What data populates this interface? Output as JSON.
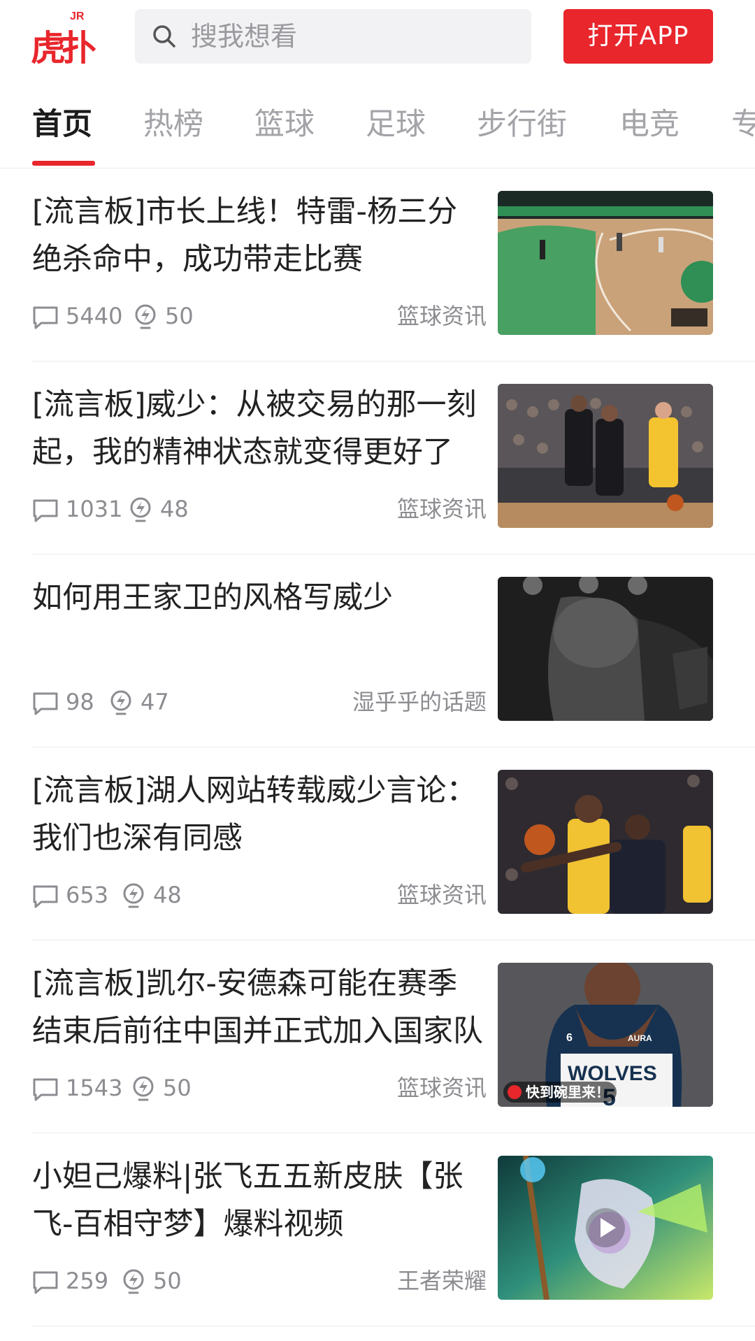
{
  "header": {
    "logo_text": "虎扑",
    "logo_superscript": "JR",
    "search_placeholder": "搜我想看",
    "open_app_label": "打开APP",
    "accent_color": "#e8262c"
  },
  "tabs": [
    {
      "label": "首页",
      "active": true
    },
    {
      "label": "热榜",
      "active": false
    },
    {
      "label": "篮球",
      "active": false
    },
    {
      "label": "足球",
      "active": false
    },
    {
      "label": "步行街",
      "active": false
    },
    {
      "label": "电竞",
      "active": false
    },
    {
      "label": "专",
      "active": false
    }
  ],
  "feed": {
    "items": [
      {
        "title": "[流言板]市长上线！特雷-杨三分绝杀命中，成功带走比赛",
        "comments": "5440",
        "lights": "50",
        "category": "篮球资讯",
        "thumbnail": "basketball-court-aerial-photo"
      },
      {
        "title": "[流言板]威少：从被交易的那一刻起，我的精神状态就变得更好了",
        "comments": "1031",
        "lights": "48",
        "category": "篮球资讯",
        "thumbnail": "clippers-vs-lakers-photo"
      },
      {
        "title": "如何用王家卫的风格写威少",
        "comments": "98",
        "lights": "47",
        "category": "湿乎乎的话题",
        "thumbnail": "westbrook-bw-photo"
      },
      {
        "title": "[流言板]湖人网站转载威少言论：我们也深有同感",
        "comments": "653",
        "lights": "48",
        "category": "篮球资讯",
        "thumbnail": "lakers-vs-clippers-photo"
      },
      {
        "title": "[流言板]凯尔-安德森可能在赛季结束后前往中国并正式加入国家队",
        "comments": "1543",
        "lights": "50",
        "category": "篮球资讯",
        "thumbnail": "wolves-player-photo",
        "badge": "快到碗里来！"
      },
      {
        "title": "小妲己爆料|张飞五五新皮肤【张飞-百相守梦】爆料视频",
        "comments": "259",
        "lights": "50",
        "category": "王者荣耀",
        "thumbnail": "game-skin-video",
        "is_video": true
      }
    ]
  }
}
